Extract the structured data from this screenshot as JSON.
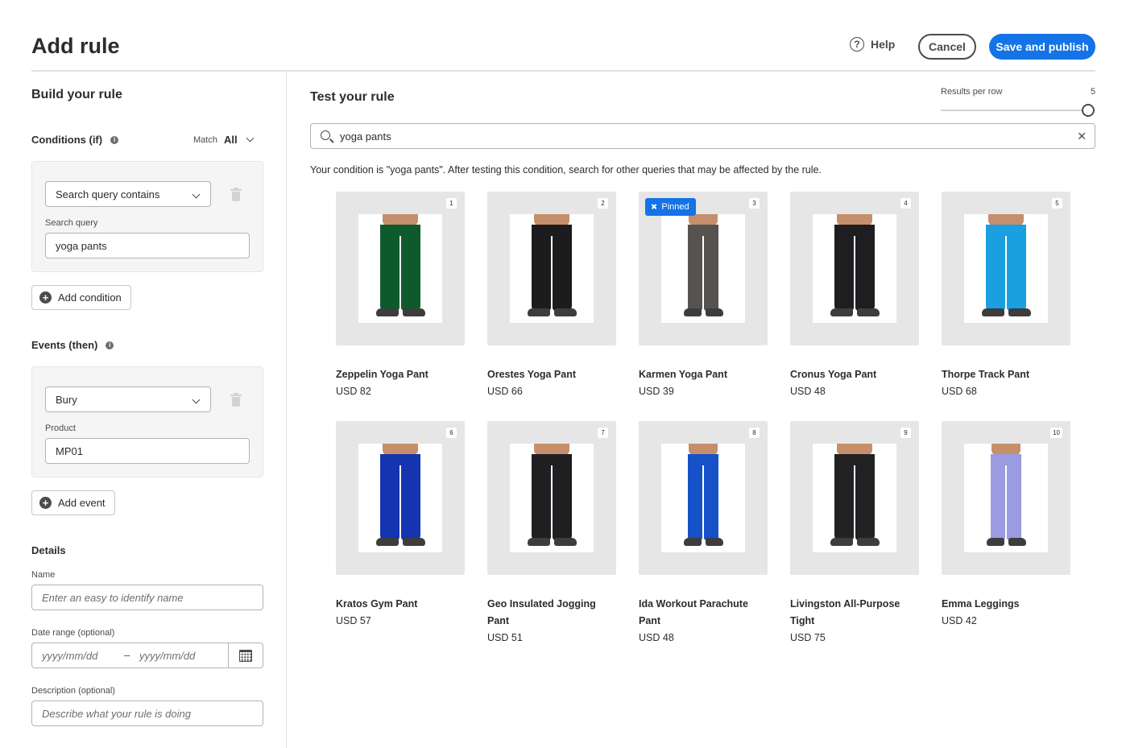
{
  "header": {
    "title": "Add rule",
    "help_label": "Help",
    "cancel_label": "Cancel",
    "publish_label": "Save and publish"
  },
  "build": {
    "title": "Build your rule",
    "conditions": {
      "title": "Conditions (if)",
      "match_label": "Match",
      "match_value": "All",
      "select_value": "Search query contains",
      "query_label": "Search query",
      "query_value": "yoga pants",
      "add_label": "Add condition"
    },
    "events": {
      "title": "Events (then)",
      "select_value": "Bury",
      "product_label": "Product",
      "product_value": "MP01",
      "add_label": "Add event"
    },
    "details": {
      "title": "Details",
      "name_label": "Name",
      "name_placeholder": "Enter an easy to identify name",
      "date_label": "Date range (optional)",
      "date_from_placeholder": "yyyy/mm/dd",
      "date_sep": "–",
      "date_to_placeholder": "yyyy/mm/dd",
      "description_label": "Description (optional)",
      "description_placeholder": "Describe what your rule is doing"
    }
  },
  "test": {
    "title": "Test your rule",
    "results_per_row_label": "Results per row",
    "results_per_row_value": "5",
    "search_value": "yoga pants",
    "condition_text": "Your condition is \"yoga pants\". After testing this condition, search for other queries that may be affected by the rule.",
    "pinned_label": "Pinned",
    "products": [
      {
        "rank": "1",
        "name": "Zeppelin Yoga Pant",
        "price": "USD 82",
        "color": "#0f5a2c",
        "slim": false,
        "pinned": false
      },
      {
        "rank": "2",
        "name": "Orestes Yoga Pant",
        "price": "USD 66",
        "color": "#1c1c1e",
        "slim": false,
        "pinned": false
      },
      {
        "rank": "3",
        "name": "Karmen Yoga Pant",
        "price": "USD 39",
        "color": "#555250",
        "slim": true,
        "pinned": true
      },
      {
        "rank": "4",
        "name": "Cronus Yoga Pant",
        "price": "USD 48",
        "color": "#1e1e20",
        "slim": false,
        "pinned": false
      },
      {
        "rank": "5",
        "name": "Thorpe Track Pant",
        "price": "USD 68",
        "color": "#1a9fe0",
        "slim": false,
        "pinned": false
      },
      {
        "rank": "6",
        "name": "Kratos Gym Pant",
        "price": "USD 57",
        "color": "#1434b0",
        "slim": false,
        "pinned": false
      },
      {
        "rank": "7",
        "name": "Geo Insulated Jogging Pant",
        "price": "USD 51",
        "color": "#1f1f21",
        "slim": false,
        "pinned": false
      },
      {
        "rank": "8",
        "name": "Ida Workout Parachute Pant",
        "price": "USD 48",
        "color": "#1651c8",
        "slim": true,
        "pinned": false
      },
      {
        "rank": "9",
        "name": "Livingston All-Purpose Tight",
        "price": "USD 75",
        "color": "#222224",
        "slim": false,
        "pinned": false
      },
      {
        "rank": "10",
        "name": "Emma Leggings",
        "price": "USD 42",
        "color": "#9a9be0",
        "slim": true,
        "pinned": false
      }
    ]
  },
  "colors": {
    "accent": "#1473e6",
    "border": "#e1e1e1",
    "thumb_bg": "#e6e6e6"
  }
}
